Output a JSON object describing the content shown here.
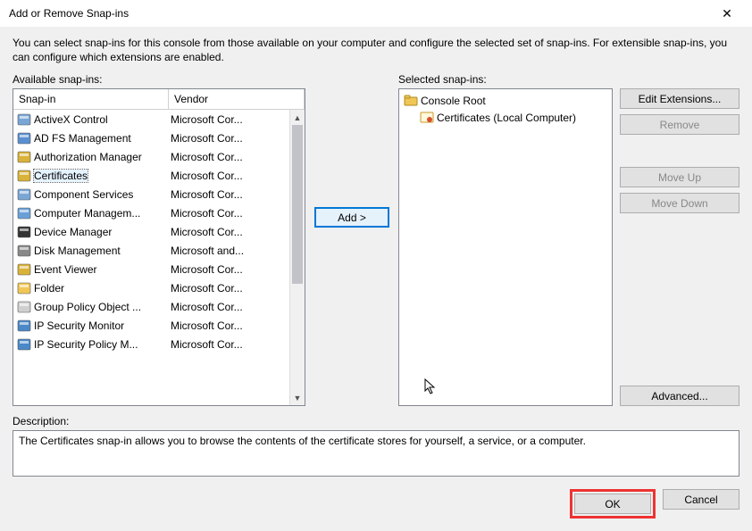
{
  "window": {
    "title": "Add or Remove Snap-ins",
    "close_label": "✕"
  },
  "intro": "You can select snap-ins for this console from those available on your computer and configure the selected set of snap-ins. For extensible snap-ins, you can configure which extensions are enabled.",
  "available": {
    "label": "Available snap-ins:",
    "columns": {
      "snapin": "Snap-in",
      "vendor": "Vendor"
    },
    "items": [
      {
        "name": "ActiveX Control",
        "vendor": "Microsoft Cor...",
        "icon": "activex"
      },
      {
        "name": "AD FS Management",
        "vendor": "Microsoft Cor...",
        "icon": "adfs"
      },
      {
        "name": "Authorization Manager",
        "vendor": "Microsoft Cor...",
        "icon": "authz"
      },
      {
        "name": "Certificates",
        "vendor": "Microsoft Cor...",
        "icon": "cert",
        "selected": true
      },
      {
        "name": "Component Services",
        "vendor": "Microsoft Cor...",
        "icon": "comp"
      },
      {
        "name": "Computer Managem...",
        "vendor": "Microsoft Cor...",
        "icon": "compmgmt"
      },
      {
        "name": "Device Manager",
        "vendor": "Microsoft Cor...",
        "icon": "device"
      },
      {
        "name": "Disk Management",
        "vendor": "Microsoft and...",
        "icon": "disk"
      },
      {
        "name": "Event Viewer",
        "vendor": "Microsoft Cor...",
        "icon": "event"
      },
      {
        "name": "Folder",
        "vendor": "Microsoft Cor...",
        "icon": "folder"
      },
      {
        "name": "Group Policy Object ...",
        "vendor": "Microsoft Cor...",
        "icon": "gpo"
      },
      {
        "name": "IP Security Monitor",
        "vendor": "Microsoft Cor...",
        "icon": "ipsec"
      },
      {
        "name": "IP Security Policy M...",
        "vendor": "Microsoft Cor...",
        "icon": "ipsec"
      }
    ]
  },
  "add_button": "Add >",
  "selected": {
    "label": "Selected snap-ins:",
    "root": "Console Root",
    "child": "Certificates (Local Computer)"
  },
  "side_buttons": {
    "edit": "Edit Extensions...",
    "remove": "Remove",
    "moveup": "Move Up",
    "movedown": "Move Down",
    "advanced": "Advanced..."
  },
  "description": {
    "label": "Description:",
    "text": "The Certificates snap-in allows you to browse the contents of the certificate stores for yourself, a service, or a computer."
  },
  "dialog": {
    "ok": "OK",
    "cancel": "Cancel"
  },
  "icons": {
    "colors": {
      "activex": "#7aa6d6",
      "adfs": "#5a8fd0",
      "authz": "#d9b23a",
      "cert": "#d9b23a",
      "comp": "#7aa6d6",
      "compmgmt": "#6aa0d8",
      "device": "#333333",
      "disk": "#888888",
      "event": "#d9b23a",
      "folder": "#f0c756",
      "gpo": "#cfcfcf",
      "ipsec": "#4a88c7",
      "root": "#f0c756",
      "certchild": "#d9b23a"
    }
  }
}
